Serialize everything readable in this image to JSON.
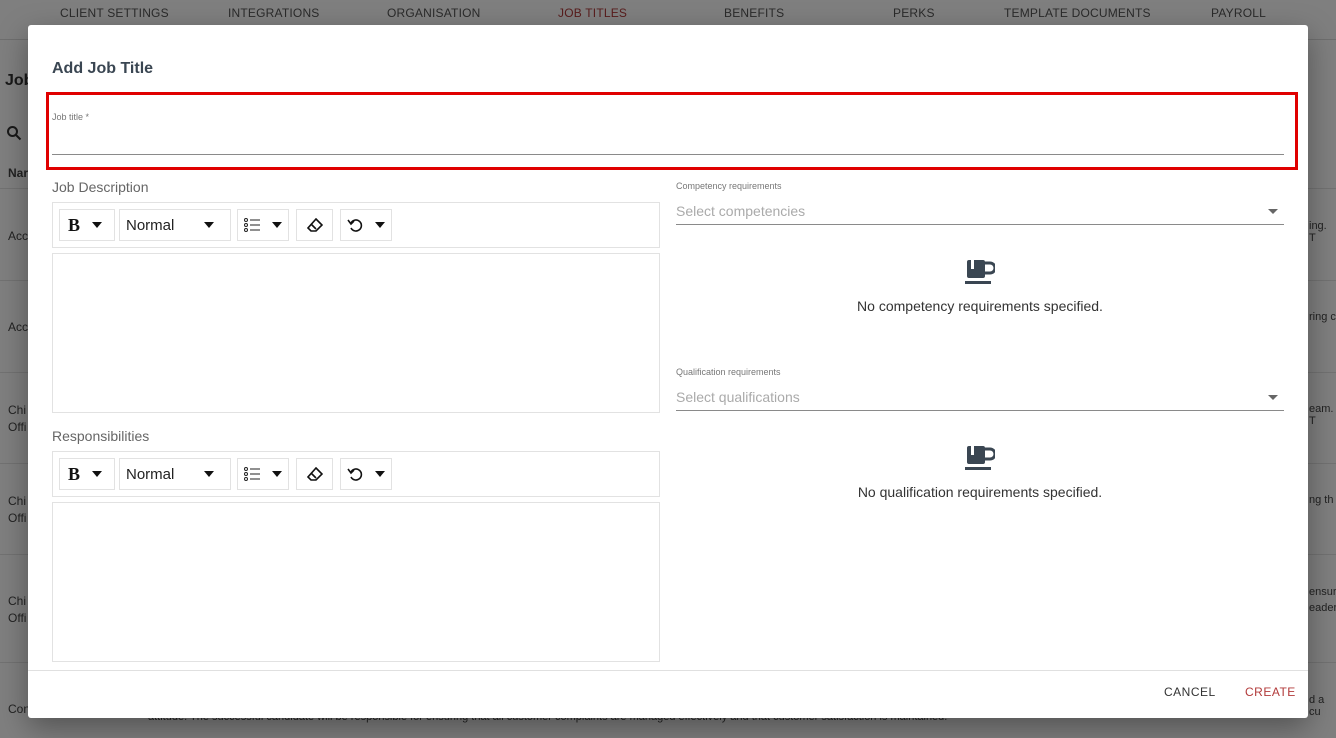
{
  "background": {
    "tabs": [
      "CLIENT SETTINGS",
      "INTEGRATIONS",
      "ORGANISATION",
      "JOB TITLES",
      "BENEFITS",
      "PERKS",
      "TEMPLATE DOCUMENTS",
      "PAYROLL"
    ],
    "page_title_fragment": "Job",
    "column_fragment": "Nar",
    "row_fragments": [
      "Acc",
      "Acc",
      "Chi",
      "Offi",
      "Chi",
      "Offi",
      "Chi",
      "Offi",
      "Con"
    ],
    "right_fragments": [
      "ing. T",
      "ring c",
      "eam. T",
      "ng th",
      "ensuri",
      "eader",
      "d a cu"
    ],
    "bottom_fragment": "attitude. The successful candidate will be responsible for ensuring that all customer complaints are managed effectively and that customer satisfaction is maintained."
  },
  "dialog": {
    "title": "Add Job Title",
    "job_title": {
      "label": "Job title *",
      "value": ""
    },
    "job_description": {
      "label": "Job Description",
      "toolbar": {
        "bold": "B",
        "format": "Normal"
      }
    },
    "responsibilities": {
      "label": "Responsibilities",
      "toolbar": {
        "bold": "B",
        "format": "Normal"
      }
    },
    "competency": {
      "label": "Competency requirements",
      "placeholder": "Select competencies",
      "empty_text": "No competency requirements specified."
    },
    "qualification": {
      "label": "Qualification requirements",
      "placeholder": "Select qualifications",
      "empty_text": "No qualification requirements specified."
    },
    "buttons": {
      "cancel": "CANCEL",
      "create": "CREATE"
    }
  },
  "colors": {
    "accent": "#b23a3a",
    "highlight": "#e00000",
    "icon": "#3a4652"
  }
}
